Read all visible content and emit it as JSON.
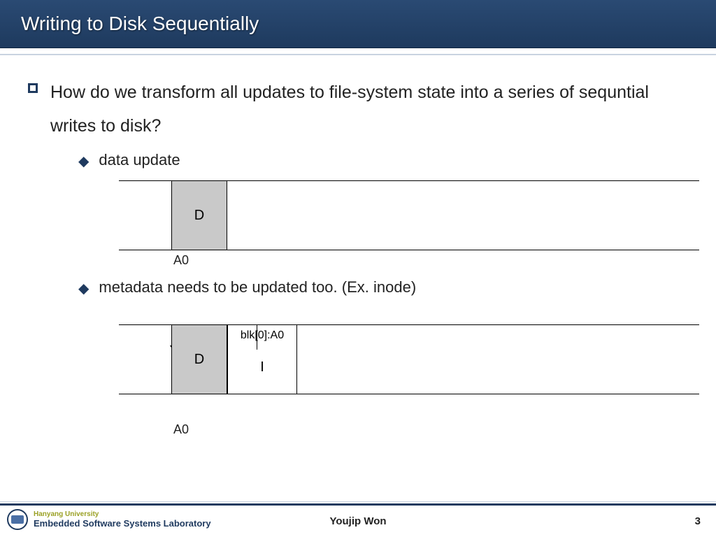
{
  "title": "Writing to Disk Sequentially",
  "main_bullet": "How do we transform all updates to file-system state into a series of sequntial writes to disk?",
  "sub1": "data update",
  "diagram1": {
    "block_d": "D",
    "addr": "A0"
  },
  "sub2": "metadata needs to be updated too. (Ex. inode)",
  "diagram2": {
    "block_d": "D",
    "blk_label": "blk[0]:A0",
    "block_i": "I",
    "addr": "A0"
  },
  "footer": {
    "university": "Hanyang University",
    "lab": "Embedded Software Systems Laboratory",
    "author": "Youjip Won",
    "page": "3"
  }
}
